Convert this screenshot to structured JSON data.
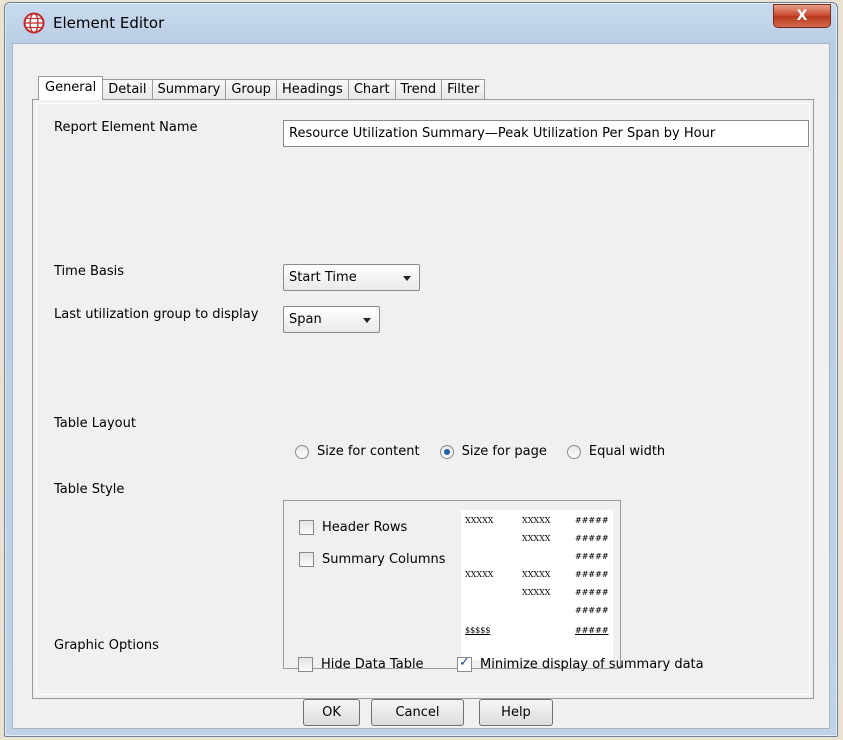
{
  "window": {
    "title": "Element Editor",
    "close_label": "X"
  },
  "tabs": [
    {
      "label": "General",
      "active": true
    },
    {
      "label": "Detail",
      "active": false
    },
    {
      "label": "Summary",
      "active": false
    },
    {
      "label": "Group",
      "active": false
    },
    {
      "label": "Headings",
      "active": false
    },
    {
      "label": "Chart",
      "active": false
    },
    {
      "label": "Trend",
      "active": false
    },
    {
      "label": "Filter",
      "active": false
    }
  ],
  "general": {
    "element_name_label": "Report Element Name",
    "element_name_value": "Resource Utilization Summary—Peak Utilization Per Span by Hour",
    "time_basis_label": "Time Basis",
    "time_basis_value": "Start Time",
    "last_group_label": "Last utilization group to display",
    "last_group_value": "Span",
    "table_layout_label": "Table Layout",
    "layout_options": [
      {
        "label": "Size for content",
        "selected": false
      },
      {
        "label": "Size for page",
        "selected": true
      },
      {
        "label": "Equal width",
        "selected": false
      }
    ],
    "table_style_label": "Table Style",
    "header_rows_label": "Header Rows",
    "header_rows_checked": false,
    "summary_columns_label": "Summary Columns",
    "summary_columns_checked": false,
    "preview": {
      "r1c1": "XXXXX",
      "r1c2": "XXXXX",
      "r1c3": "#####",
      "r2c2": "XXXXX",
      "r2c3": "#####",
      "r3c3": "#####",
      "r4c1": "XXXXX",
      "r4c2": "XXXXX",
      "r4c3": "#####",
      "r5c2": "XXXXX",
      "r5c3": "#####",
      "r6c3": "#####",
      "r7c1": "$$$$$",
      "r7c3": "#####"
    },
    "graphic_options_label": "Graphic Options",
    "hide_data_table_label": "Hide Data Table",
    "hide_data_table_checked": false,
    "minimize_summary_label": "Minimize display of summary data",
    "minimize_summary_checked": true
  },
  "buttons": {
    "ok": "OK",
    "cancel": "Cancel",
    "help": "Help"
  },
  "colors": {
    "accent": "#1f5fa8",
    "close_button": "#c8462a",
    "title_icon": "#c0282c"
  }
}
